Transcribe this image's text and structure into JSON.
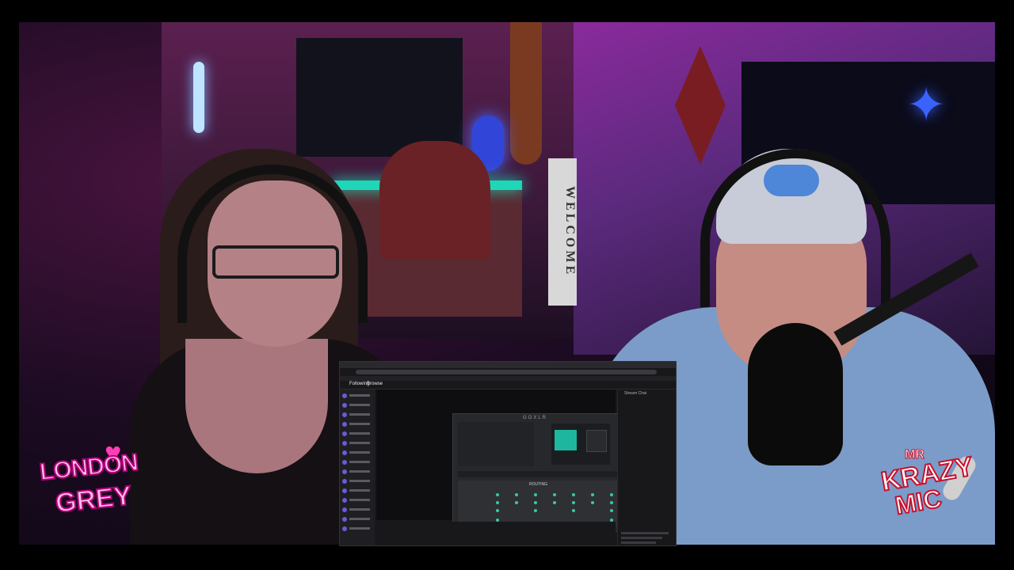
{
  "scene": {
    "description_words": [
      "WELCOME"
    ],
    "colors": {
      "neon_teal": "#1fd6b8",
      "neon_blue": "#3a62ff",
      "room_purple": "#8a2a9c",
      "twitch_purple": "#6d5ad8"
    }
  },
  "logos": {
    "left": {
      "line1": "LONDON",
      "line2": "GREY",
      "color": "#ff3db4"
    },
    "right": {
      "line1": "MR",
      "line2": "KRAZY",
      "line3": "MIC",
      "color": "#c8102e"
    }
  },
  "screen": {
    "nav": {
      "following": "Following",
      "browse": "Browse"
    },
    "app_logo": "GOXLR",
    "routing_title": "ROUTING",
    "chat_header": "Stream Chat"
  }
}
